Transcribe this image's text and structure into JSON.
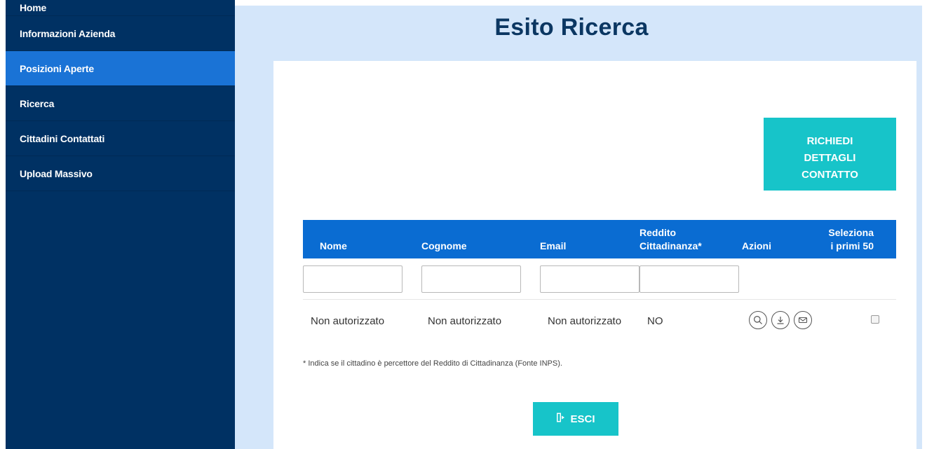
{
  "sidebar": {
    "items": [
      {
        "label": "Home"
      },
      {
        "label": "Informazioni Azienda"
      },
      {
        "label": "Posizioni Aperte"
      },
      {
        "label": "Ricerca"
      },
      {
        "label": "Cittadini Contattati"
      },
      {
        "label": "Upload Massivo"
      }
    ],
    "active": "Posizioni Aperte"
  },
  "page": {
    "title": "Esito Ricerca"
  },
  "request_button": {
    "line1": "RICHIEDI",
    "line2": "DETTAGLI",
    "line3": "CONTATTO"
  },
  "table": {
    "headers": {
      "nome": "Nome",
      "cognome": "Cognome",
      "email": "Email",
      "reddito_line1": "Reddito",
      "reddito_line2": "Cittadinanza*",
      "azioni": "Azioni",
      "seleziona_line1": "Seleziona",
      "seleziona_line2": "i primi 50"
    },
    "filters": {
      "nome": "",
      "cognome": "",
      "email": "",
      "reddito": ""
    },
    "rows": [
      {
        "nome": "Non autorizzato",
        "cognome": "Non autorizzato",
        "email": "Non autorizzato",
        "reddito": "NO",
        "actions": [
          "search-icon",
          "download-icon",
          "mail-icon"
        ],
        "selected": false
      }
    ]
  },
  "footnote": "* Indica se il cittadino è percettore del Reddito di Cittadinanza (Fonte INPS).",
  "exit_button": {
    "label": "ESCI",
    "icon": "exit-door-icon"
  },
  "colors": {
    "sidebar": "#003163",
    "sidebar_active": "#1a73d6",
    "background": "#d4e6fa",
    "title": "#0b3762",
    "accent": "#17c4c9",
    "table_header": "#0a6cd2"
  }
}
